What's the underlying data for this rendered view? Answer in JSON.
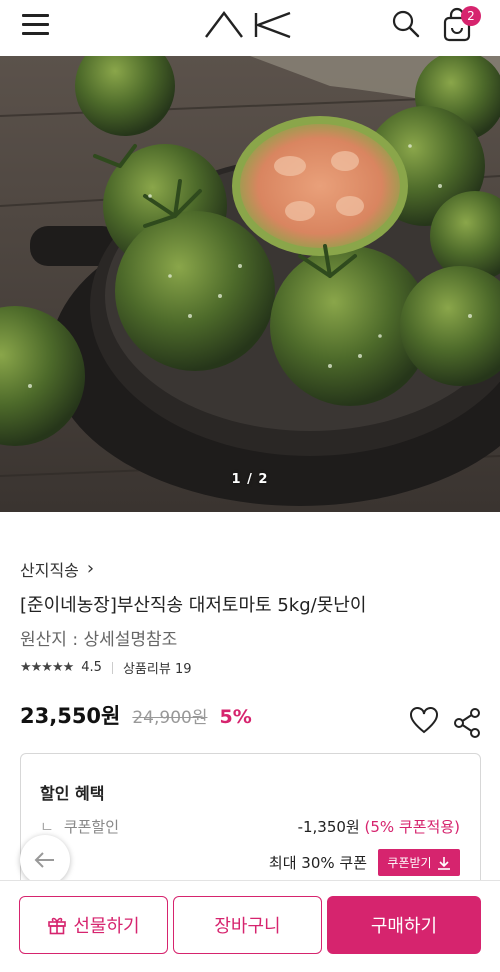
{
  "header": {
    "logo_text": "AK",
    "cart_count": "2"
  },
  "hero": {
    "counter": "1 / 2"
  },
  "product": {
    "seller": "산지직송",
    "title": "[준이네농장]부산직송 대저토마토 5kg/못난이",
    "origin": "원산지 : 상세설명참조",
    "rating": 4.5,
    "rating_label": "4.5",
    "stars": "★★★★★",
    "review_label": "상품리뷰 19",
    "price": "23,550원",
    "original_price": "24,900원",
    "discount_rate": "5%"
  },
  "benefits": {
    "title": "할인 혜택",
    "coupon_prefix": "ㄴ",
    "coupon_label": "쿠폰할인",
    "coupon_amount": "-1,350원",
    "coupon_note": "(5% 쿠폰적용)",
    "max_coupon": "최대 30% 쿠폰",
    "download_label": "쿠폰받기"
  },
  "actions": {
    "gift_label": "선물하기",
    "cart_label": "장바구니",
    "buy_label": "구매하기"
  },
  "colors": {
    "accent": "#d6246e"
  }
}
